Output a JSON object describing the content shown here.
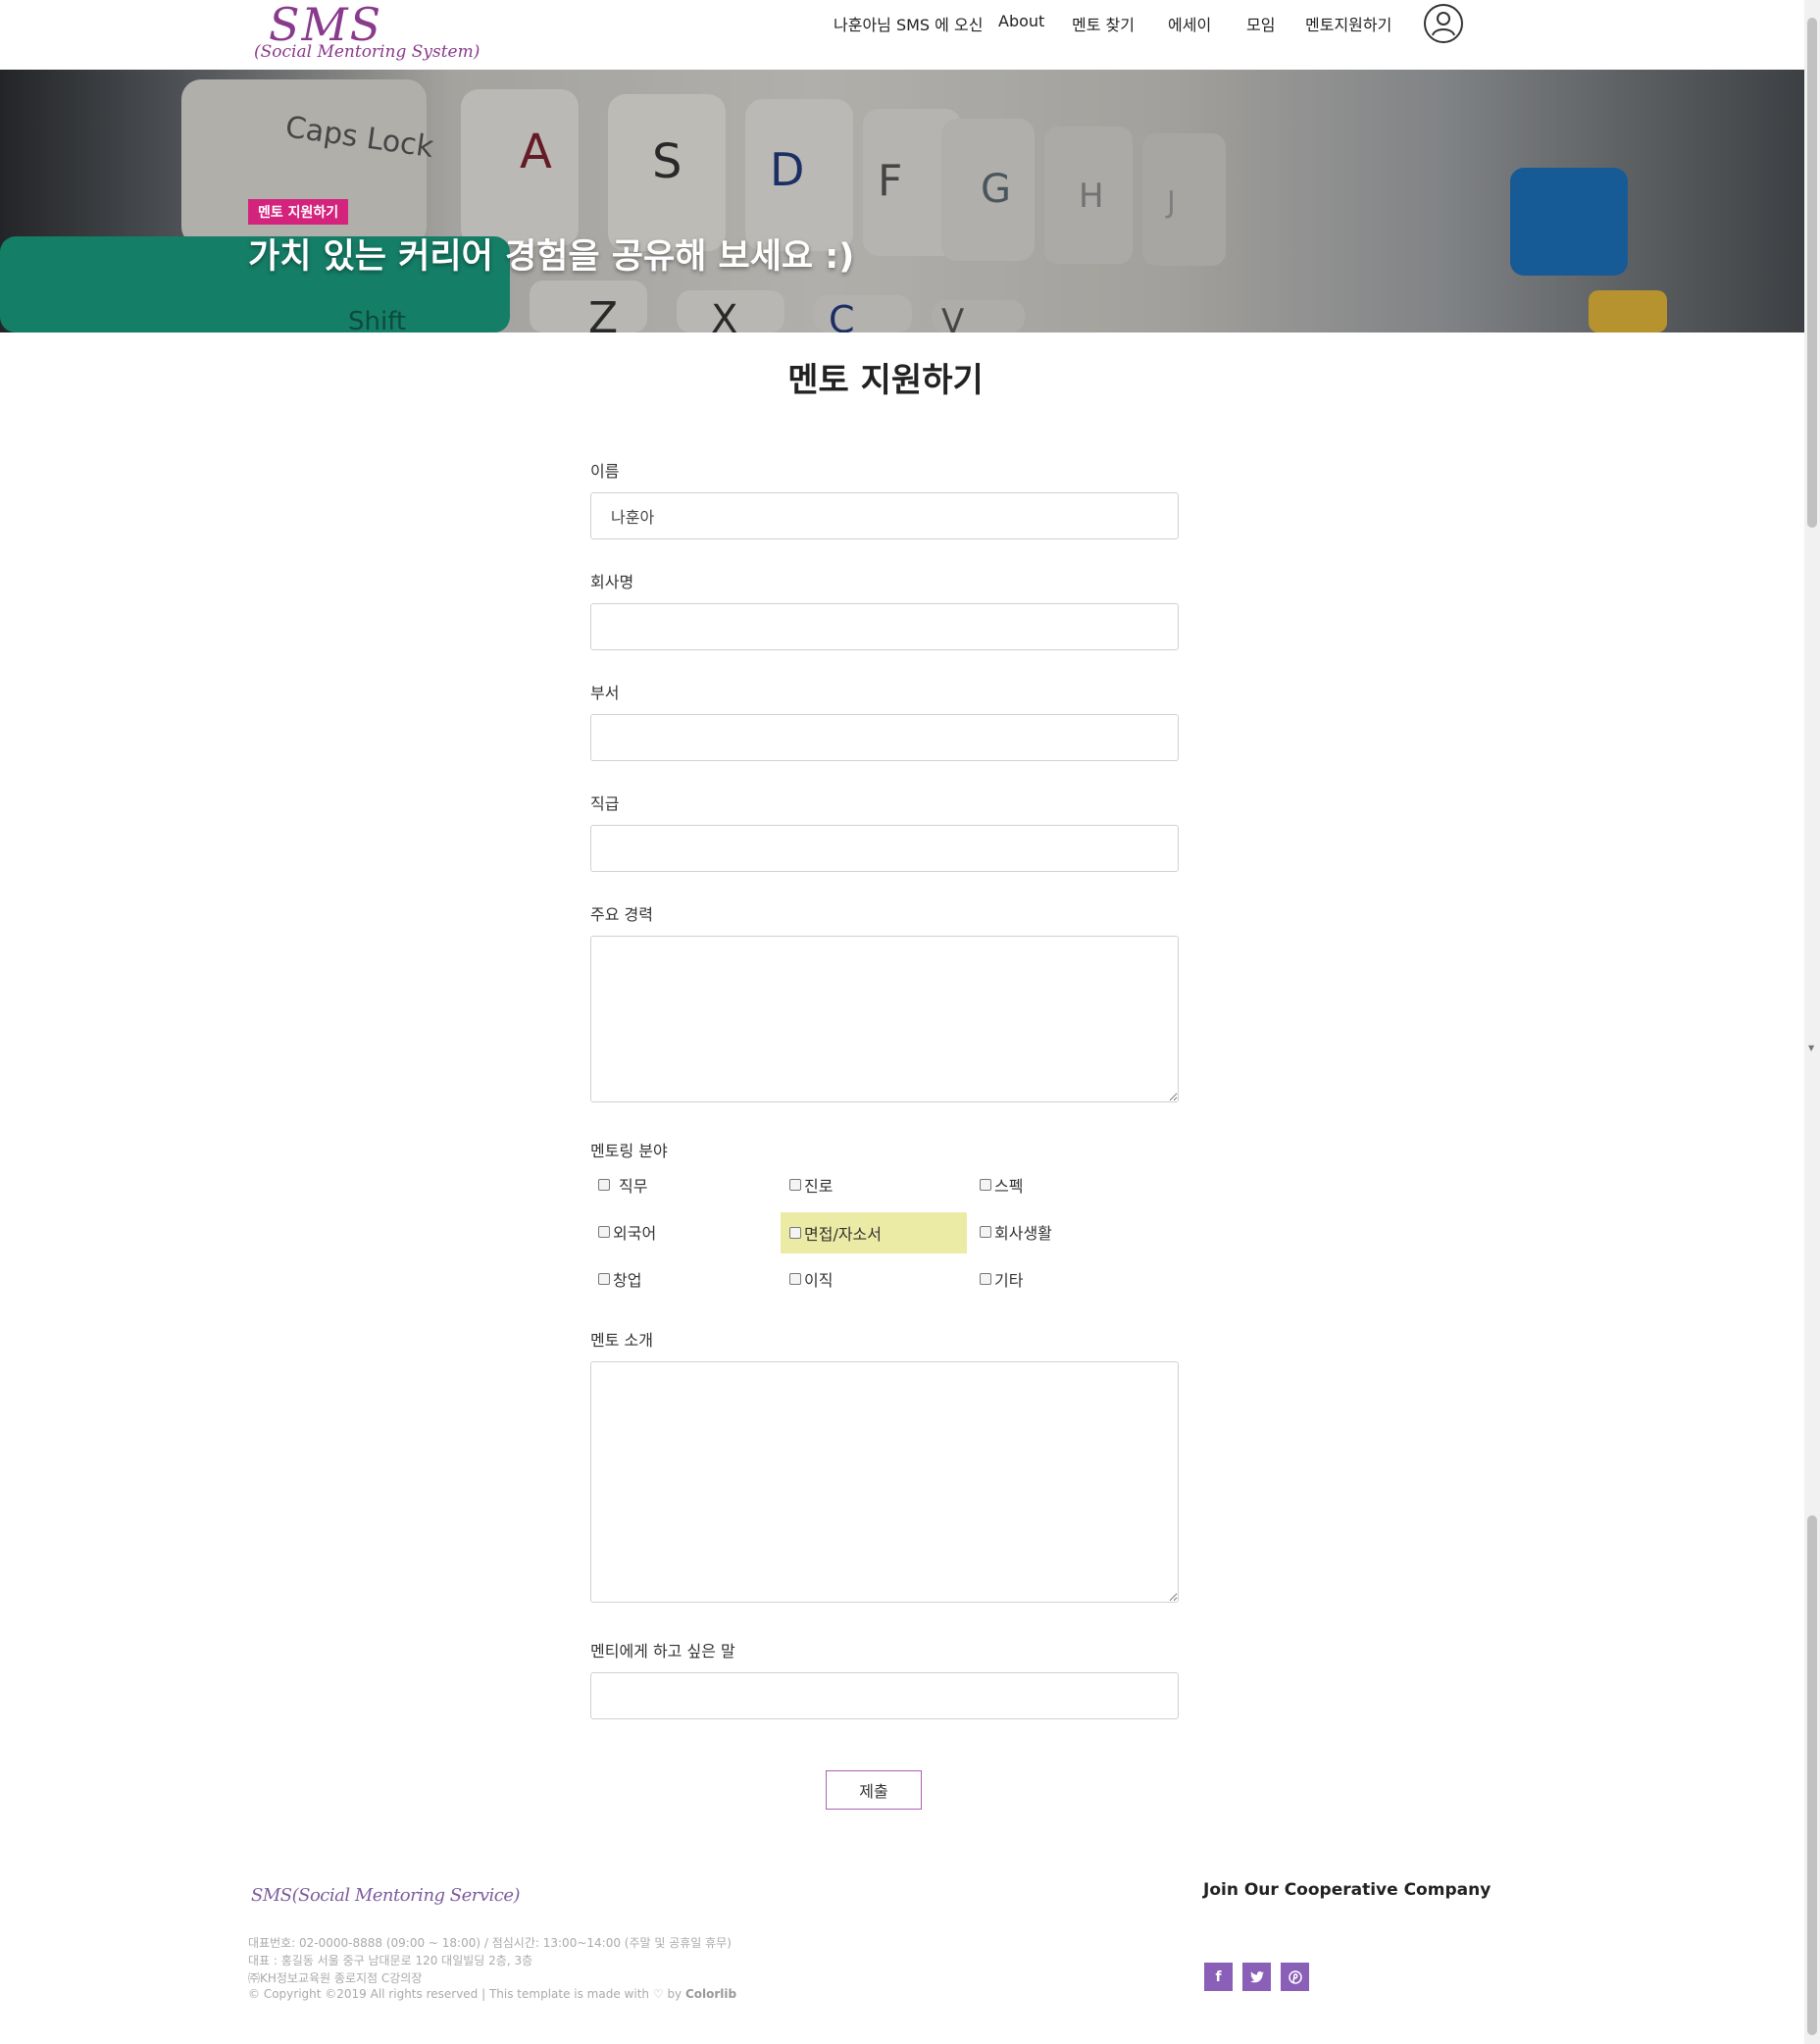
{
  "header": {
    "logo_main": "SMS",
    "logo_sub": "(Social Mentoring System)",
    "nav": [
      "나훈아님 SMS 에 오신",
      "About",
      "멘토 찾기",
      "에세이",
      "모임",
      "멘토지원하기"
    ]
  },
  "hero": {
    "badge": "멘토 지원하기",
    "title": "가치 있는 커리어 경험을 공유해 보세요 :)",
    "key_labels": [
      "Caps Lock",
      "A",
      "S",
      "D",
      "F",
      "G",
      "H",
      "J",
      "Shift",
      "Z",
      "X",
      "C",
      "V"
    ]
  },
  "form": {
    "title": "멘토 지원하기",
    "name_label": "이름",
    "name_value": "나훈아",
    "company_label": "회사명",
    "dept_label": "부서",
    "rank_label": "직급",
    "career_label": "주요 경력",
    "field_label": "멘토링 분야",
    "fields": [
      "직무",
      "진로",
      "스펙",
      "외국어",
      "면접/자소서",
      "회사생활",
      "창업",
      "이직",
      "기타"
    ],
    "intro_label": "멘토 소개",
    "message_label": "멘티에게 하고 싶은 말",
    "submit": "제출"
  },
  "footer": {
    "logo": "SMS(Social Mentoring Service)",
    "phone": "대표번호: 02-0000-8888 (09:00 ~ 18:00) / 점심시간: 13:00~14:00 (주말 및 공휴일 휴무)",
    "address": "대표 : 홍길동 서울 중구 남대문로 120 대일빌딩 2층, 3층",
    "branch": "㈜KH정보교육원 종로지점 C강의장",
    "copyright_prefix": "© Copyright ©2019 All rights reserved | This template is made with",
    "copyright_by": "by",
    "copyright_brand": "Colorlib",
    "heading": "Join Our Cooperative Company"
  },
  "colors": {
    "brand": "#8a3a8c",
    "badge": "#d4237c",
    "social": "#8a5fb8",
    "highlight": "#eceba6"
  },
  "icons": [
    "user-icon",
    "heart-icon",
    "facebook-icon",
    "twitter-icon",
    "pinterest-icon"
  ]
}
